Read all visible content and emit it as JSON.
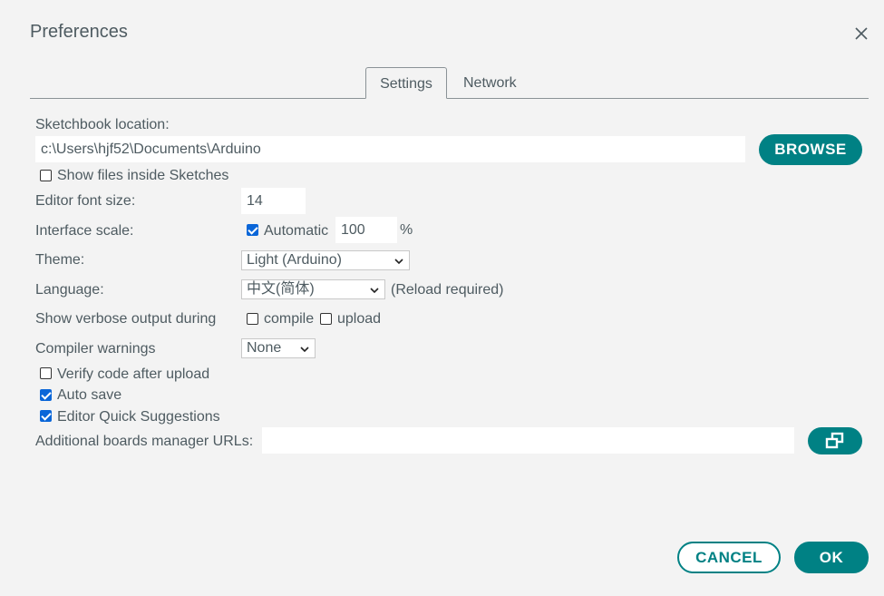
{
  "dialog": {
    "title": "Preferences"
  },
  "tabs": [
    {
      "label": "Settings",
      "active": true
    },
    {
      "label": "Network",
      "active": false
    }
  ],
  "settings": {
    "sketchbook_label": "Sketchbook location:",
    "sketchbook_path": "c:\\Users\\hjf52\\Documents\\Arduino",
    "browse_label": "BROWSE",
    "show_files_label": "Show files inside Sketches",
    "show_files_checked": false,
    "font_size_label": "Editor font size:",
    "font_size_value": "14",
    "scale_label": "Interface scale:",
    "scale_auto_label": "Automatic",
    "scale_auto_checked": true,
    "scale_value": "100",
    "scale_unit": "%",
    "theme_label": "Theme:",
    "theme_value": "Light (Arduino)",
    "language_label": "Language:",
    "language_value": "中文(简体)",
    "language_note": "(Reload required)",
    "verbose_label": "Show verbose output during",
    "verbose_compile_label": "compile",
    "verbose_compile_checked": false,
    "verbose_upload_label": "upload",
    "verbose_upload_checked": false,
    "warnings_label": "Compiler warnings",
    "warnings_value": "None",
    "verify_label": "Verify code after upload",
    "verify_checked": false,
    "autosave_label": "Auto save",
    "autosave_checked": true,
    "quick_suggestions_label": "Editor Quick Suggestions",
    "quick_suggestions_checked": true,
    "boards_urls_label": "Additional boards manager URLs:",
    "boards_urls_value": ""
  },
  "footer": {
    "cancel_label": "CANCEL",
    "ok_label": "OK"
  },
  "colors": {
    "accent": "#008184",
    "checkbox": "#0a66d8",
    "text": "#4e5b61",
    "background": "#f3f3f3"
  },
  "icons": {
    "close": "close-icon",
    "chevron": "chevron-down-icon",
    "open_window": "open-window-icon"
  }
}
